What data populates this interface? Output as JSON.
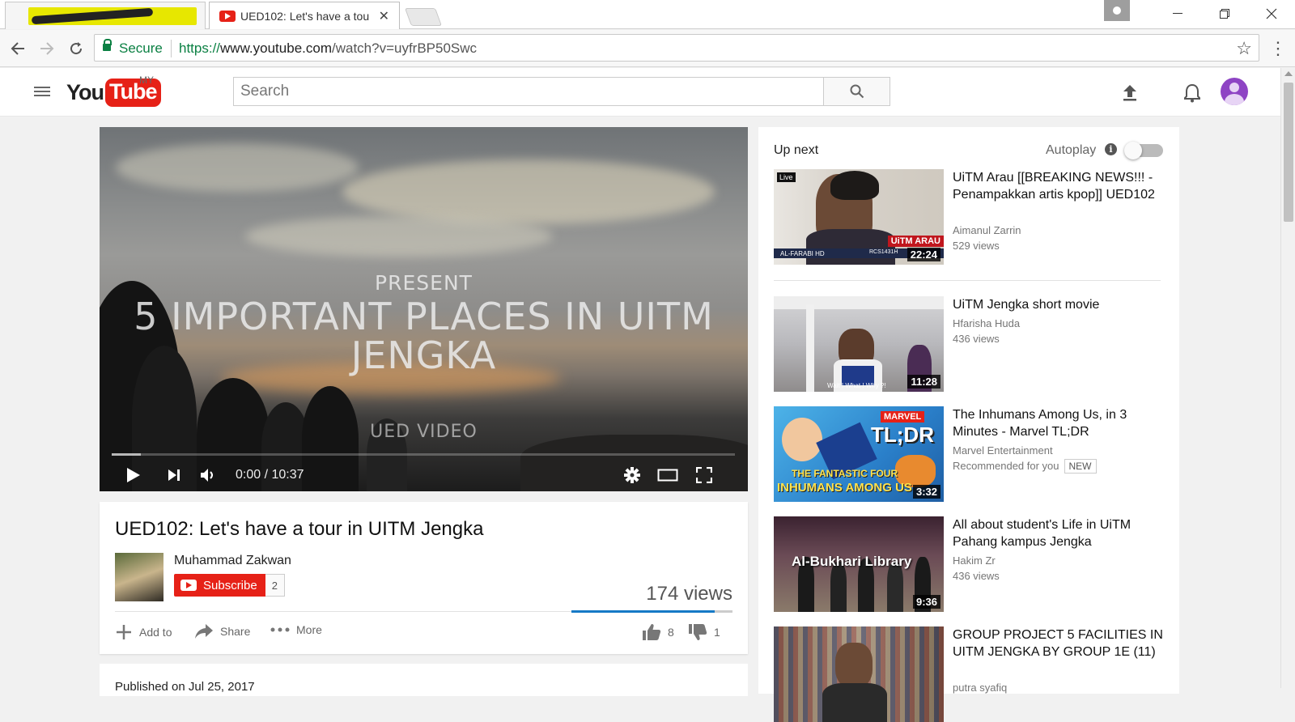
{
  "browser": {
    "tabs": [
      {
        "label": "",
        "redacted": true
      },
      {
        "label": "UED102: Let's have a tou",
        "active": true
      }
    ],
    "address": {
      "secure_label": "Secure",
      "url_protocol": "https://",
      "url_host": "www.youtube.com",
      "url_path": "/watch?v=uyfrBP50Swc"
    }
  },
  "header": {
    "logo_you": "You",
    "logo_tube": "Tube",
    "country_code": "MY",
    "search_placeholder": "Search"
  },
  "player": {
    "overlay_present": "PRESENT",
    "overlay_title": "5 IMPORTANT PLACES IN UITM JENGKA",
    "overlay_footer": "UED VIDEO",
    "time": "0:00 / 10:37",
    "buffered_fraction": 0.047
  },
  "video": {
    "title": "UED102: Let's have a tour in UITM Jengka",
    "channel": "Muhammad Zakwan",
    "subscribe_label": "Subscribe",
    "subscriber_count": "2",
    "views": "174 views",
    "actions": {
      "add_to": "Add to",
      "share": "Share",
      "more": "More"
    },
    "likes": "8",
    "dislikes": "1",
    "like_ratio": 0.89,
    "published": "Published on Jul 25, 2017"
  },
  "sidebar": {
    "up_next_label": "Up next",
    "autoplay_label": "Autoplay",
    "autoplay_on": false,
    "items": [
      {
        "title": "UiTM Arau [[BREAKING NEWS!!! - Penampakkan artis kpop]] UED102",
        "channel": "Aimanul Zarrin",
        "views": "529 views",
        "duration": "22:24"
      },
      {
        "title": "UiTM Jengka short movie",
        "channel": "Hfarisha Huda",
        "views": "436 views",
        "duration": "11:28"
      },
      {
        "title": "The Inhumans Among Us, in 3 Minutes - Marvel TL;DR",
        "channel": "Marvel Entertainment",
        "views": "Recommended for you",
        "badge": "NEW",
        "duration": "3:32"
      },
      {
        "title": "All about student's Life in UiTM Pahang kampus Jengka",
        "channel": "Hakim Zr",
        "views": "436 views",
        "duration": "9:36"
      },
      {
        "title": "GROUP PROJECT 5 FACILITIES IN UITM JENGKA BY GROUP 1E (11)",
        "channel": "putra syafiq",
        "views": "",
        "duration": ""
      }
    ],
    "thumb_texts": {
      "item0_live": "Live",
      "item0_banner": "UiTM ARAU",
      "item0_ticker": "AL-FARABI HD",
      "item0_code": "RCS1431H",
      "item1_caption": "Wait ! What ! Why ?!",
      "item2_brand": "MARVEL",
      "item2_logo": "TL;DR",
      "item2_line1": "THE FANTASTIC FOUR",
      "item2_line2": "INHUMANS AMONG US",
      "item3_caption": "Al-Bukhari Library"
    }
  }
}
